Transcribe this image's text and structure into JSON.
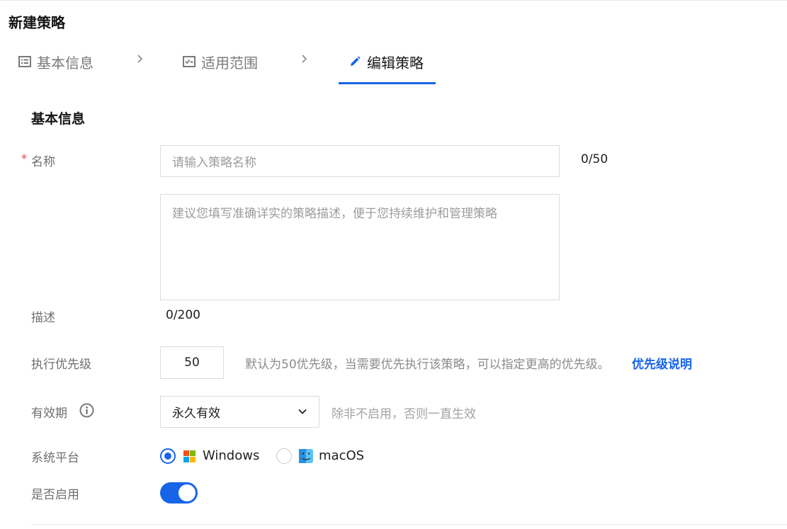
{
  "page": {
    "title": "新建策略"
  },
  "steps": [
    {
      "label": "基本信息",
      "icon": "list-icon",
      "state": "done"
    },
    {
      "label": "适用范围",
      "icon": "checklist-icon",
      "state": "done"
    },
    {
      "label": "编辑策略",
      "icon": "pencil-icon",
      "state": "active"
    }
  ],
  "section": {
    "title": "基本信息"
  },
  "form": {
    "name": {
      "label": "名称",
      "required_mark": "*",
      "placeholder": "请输入策略名称",
      "counter": "0/50"
    },
    "description": {
      "label": "描述",
      "placeholder": "建议您填写准确详实的策略描述，便于您持续维护和管理策略",
      "counter": "0/200"
    },
    "priority": {
      "label": "执行优先级",
      "value": "50",
      "hint": "默认为50优先级，当需要优先执行该策略，可以指定更高的优先级。",
      "link": "优先级说明"
    },
    "validity": {
      "label": "有效期",
      "selected": "永久有效",
      "hint": "除非不启用，否则一直生效"
    },
    "platform": {
      "label": "系统平台",
      "options": [
        "Windows",
        "macOS"
      ],
      "selected": "Windows"
    },
    "enabled": {
      "label": "是否启用",
      "value": true
    }
  },
  "colors": {
    "accent": "#1764e8",
    "required": "#e5413a"
  }
}
